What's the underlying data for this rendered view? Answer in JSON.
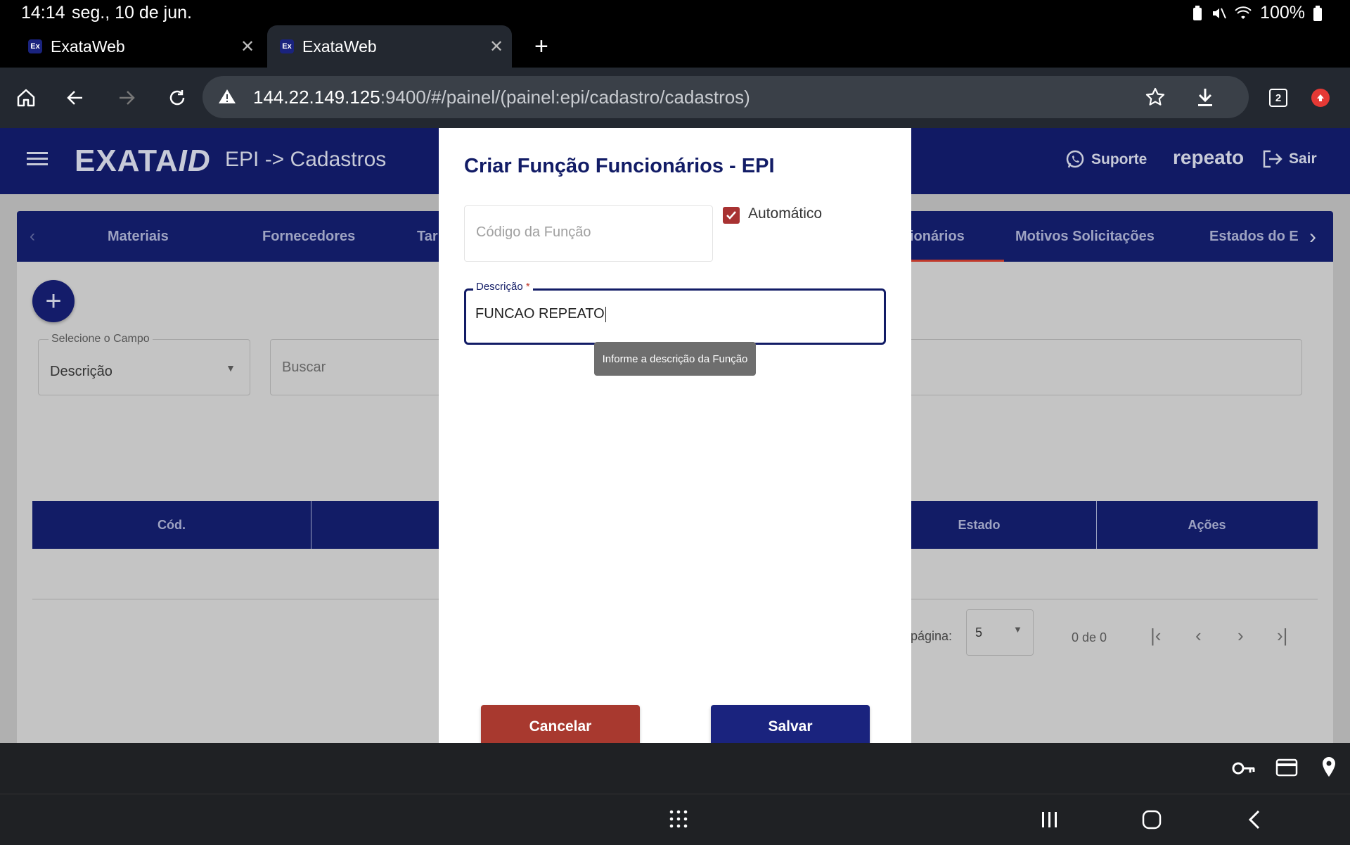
{
  "status": {
    "time": "14:14",
    "date": "seg., 10 de jun.",
    "battery": "100%"
  },
  "browser": {
    "tabs": [
      {
        "favicon": "Ex",
        "title": "ExataWeb"
      },
      {
        "favicon": "Ex",
        "title": "ExataWeb"
      }
    ],
    "tab_count": "2",
    "url_host": "144.22.149.125",
    "url_rest": ":9400/#/painel/(painel:epi/cadastro/cadastros)"
  },
  "app": {
    "logo_main": "EXATA",
    "logo_suffix": "ID",
    "page_title": "EPI -> Cadastros",
    "support_label": "Suporte",
    "user_name": "repeato",
    "logout_label": "Sair",
    "nav_tabs": [
      "Materiais",
      "Fornecedores",
      "Tar",
      "ionários",
      "Motivos Solicitações",
      "Estados do E"
    ],
    "filter": {
      "label": "Selecione o Campo",
      "value": "Descrição",
      "search_placeholder": "Buscar"
    },
    "table": {
      "headers": [
        "Cód.",
        "Estado",
        "Ações"
      ]
    },
    "pagination": {
      "per_page_label": "r página:",
      "per_page_value": "5",
      "range": "0 de 0"
    }
  },
  "dialog": {
    "title": "Criar Função Funcionários - EPI",
    "code_placeholder": "Código da Função",
    "auto_label": "Automático",
    "auto_checked": true,
    "desc_label": "Descrição",
    "desc_required": "*",
    "desc_value": "FUNCAO REPEATO",
    "tooltip": "Informe a descrição da Função",
    "cancel_label": "Cancelar",
    "save_label": "Salvar"
  },
  "colors": {
    "primary": "#121c66",
    "danger": "#a8392f",
    "tab_indicator": "#c0392b"
  }
}
